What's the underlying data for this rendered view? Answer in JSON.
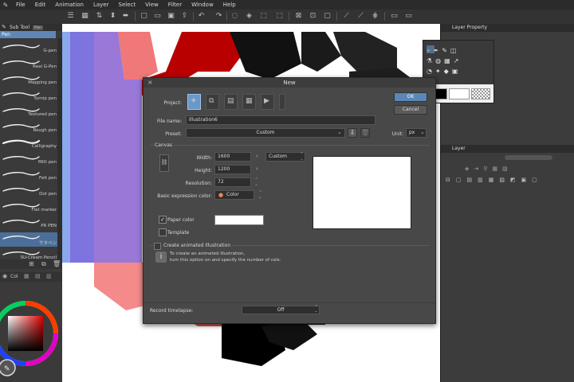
{
  "menu": [
    "File",
    "Edit",
    "Animation",
    "Layer",
    "Select",
    "View",
    "Filter",
    "Window",
    "Help"
  ],
  "subtool": {
    "header": "Sub Tool",
    "tag": "Pen",
    "group_tab": "Pen",
    "brushes": [
      "G-pen",
      "Real G-Pen",
      "Mapping pen",
      "Turnip pen",
      "Textured pen",
      "Rough pen",
      "Calligraphy",
      "Milli pen",
      "Felt pen",
      "Dot pen",
      "Flat marker",
      "PR PEN",
      "サタペン",
      "SU-Cream Pencil"
    ],
    "selected_index": 12
  },
  "color_panel_label": "Col",
  "right": {
    "layer_property": "Layer Property",
    "layer": "Layer"
  },
  "dialog": {
    "title": "New",
    "project_label": "Project:",
    "file_name_label": "File name:",
    "file_name": "Illustration6",
    "preset_label": "Preset:",
    "preset": "Custom",
    "unit_label": "Unit:",
    "unit": "px",
    "ok": "OK",
    "cancel": "Cancel",
    "canvas_section": "Canvas",
    "width_label": "Width:",
    "width": "1600",
    "height_label": "Height:",
    "height": "1200",
    "size_preset": "Custom",
    "resolution_label": "Resolution:",
    "resolution": "72",
    "basic_color_label": "Basic expression color:",
    "basic_color": "Color",
    "paper_color_label": "Paper color",
    "paper_color_checked": true,
    "paper_color_value": "#ffffff",
    "template_label": "Template",
    "template_checked": false,
    "anim_label": "Create animated illustration",
    "anim_info_line1": "To create an animated illustration,",
    "anim_info_line2": "turn this option on and specify the number of cels.",
    "timelapse_label": "Record timelapse:",
    "timelapse": "Off"
  }
}
